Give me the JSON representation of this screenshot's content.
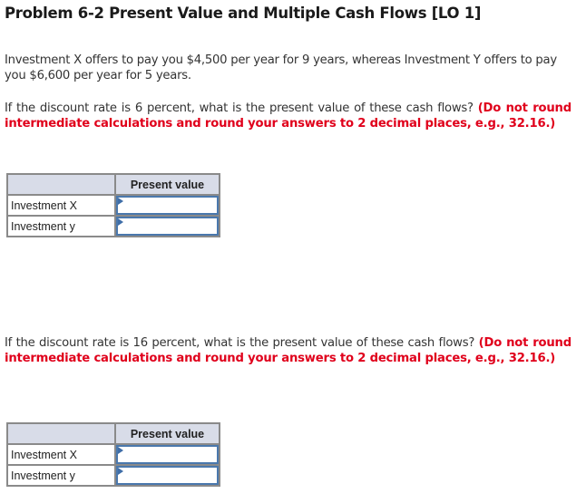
{
  "title": "Problem 6-2 Present Value and Multiple Cash Flows [LO 1]",
  "intro": "Investment X offers to pay you $4,500 per year for 9 years, whereas Investment Y offers to pay you $6,600 per year for 5 years.",
  "part1": {
    "question": "If the discount rate is 6 percent, what is the present value of these cash flows?",
    "instruction": "(Do not round intermediate calculations and round your answers to 2 decimal places, e.g., 32.16.)",
    "table": {
      "header_blank": "",
      "header_value": "Present value",
      "rows": [
        {
          "label": "Investment X",
          "value": ""
        },
        {
          "label": "Investment y",
          "value": ""
        }
      ]
    }
  },
  "part2": {
    "question": "If the discount rate is 16 percent, what is the present value of these cash flows?",
    "instruction": "(Do not round intermediate calculations and round your answers to 2 decimal places, e.g., 32.16.)",
    "table": {
      "header_blank": "",
      "header_value": "Present value",
      "rows": [
        {
          "label": "Investment X",
          "value": ""
        },
        {
          "label": "Investment y",
          "value": ""
        }
      ]
    }
  },
  "colors": {
    "instruction_red": "#e0001b",
    "header_bg": "#d8dce8",
    "input_border": "#4a78ad"
  }
}
